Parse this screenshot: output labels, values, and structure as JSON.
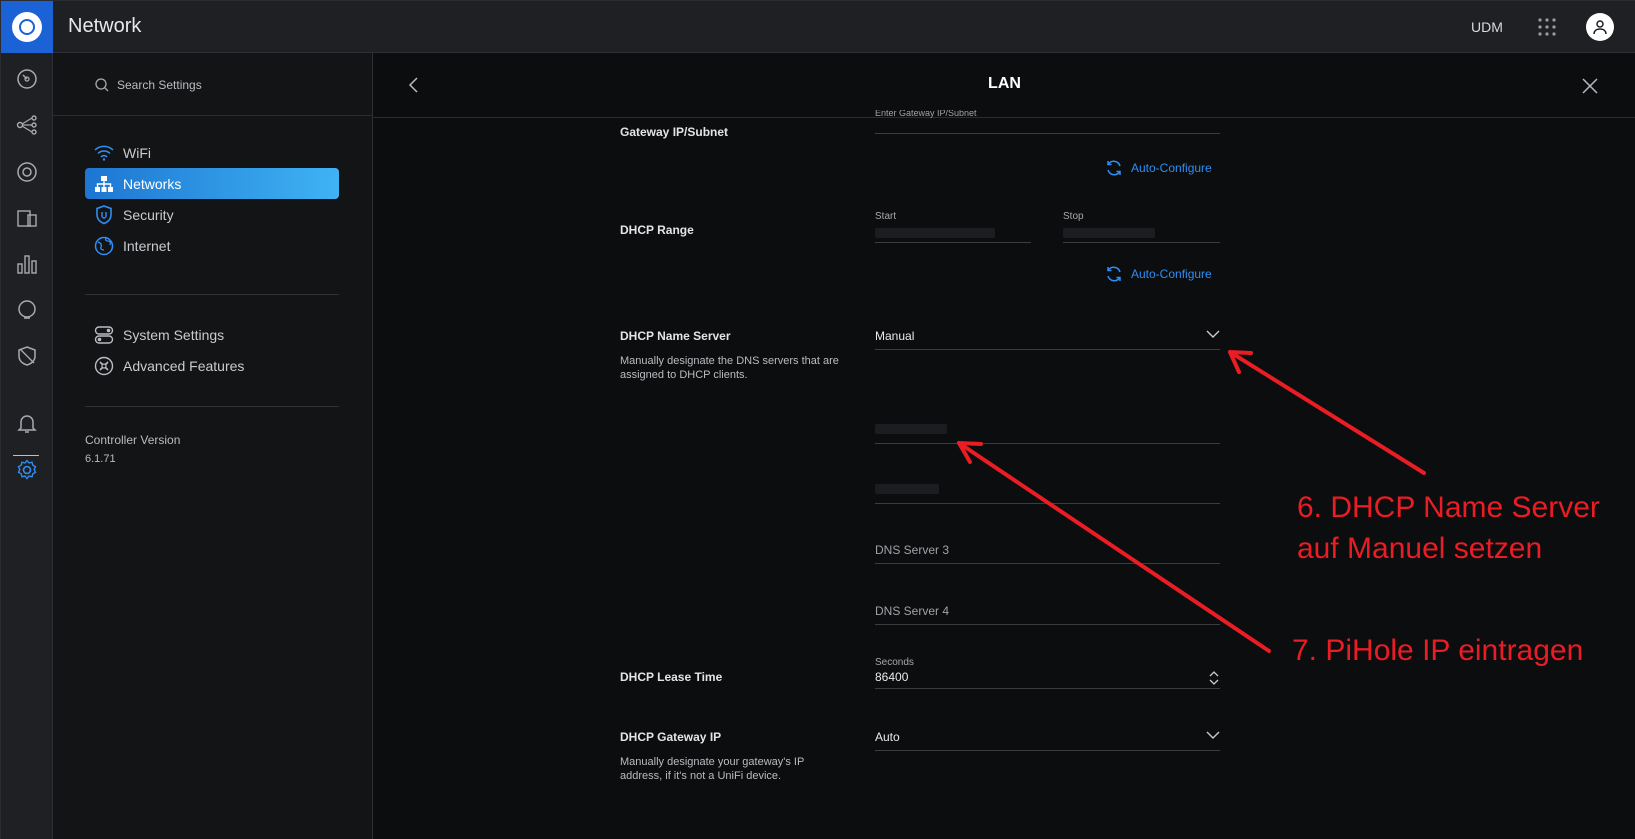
{
  "app": {
    "title": "Network",
    "device": "UDM"
  },
  "sidebar": {
    "search_placeholder": "Search Settings",
    "items": [
      {
        "label": "WiFi",
        "icon": "wifi-icon"
      },
      {
        "label": "Networks",
        "icon": "networks-icon",
        "active": true
      },
      {
        "label": "Security",
        "icon": "shield-icon"
      },
      {
        "label": "Internet",
        "icon": "globe-icon"
      }
    ],
    "items2": [
      {
        "label": "System Settings",
        "icon": "toggles-icon"
      },
      {
        "label": "Advanced Features",
        "icon": "tools-icon"
      }
    ],
    "controller_label": "Controller Version",
    "controller_version": "6.1.71"
  },
  "rail": {
    "icons": [
      "dashboard-icon",
      "topology-icon",
      "devices-icon",
      "clients-icon",
      "statistics-icon",
      "insights-icon",
      "traffic-icon",
      "alerts-icon",
      "settings-icon"
    ]
  },
  "panel": {
    "title": "LAN",
    "gateway": {
      "label": "Gateway IP/Subnet",
      "placeholder": "Enter Gateway IP/Subnet",
      "auto_configure": "Auto-Configure"
    },
    "dhcp_range": {
      "label": "DHCP Range",
      "start_label": "Start",
      "stop_label": "Stop",
      "auto_configure": "Auto-Configure"
    },
    "dhcp_name_server": {
      "label": "DHCP Name Server",
      "value": "Manual",
      "description": "Manually designate the DNS servers that are assigned to DHCP clients.",
      "dns3_placeholder": "DNS Server 3",
      "dns4_placeholder": "DNS Server 4"
    },
    "lease_time": {
      "label": "DHCP Lease Time",
      "unit_label": "Seconds",
      "value": "86400"
    },
    "gateway_ip": {
      "label": "DHCP Gateway IP",
      "value": "Auto",
      "description": "Manually designate your gateway's IP address, if it's not a UniFi device."
    }
  },
  "annotations": {
    "step6_line1": "6. DHCP Name Server",
    "step6_line2": "auf Manuel setzen",
    "step7": "7. PiHole IP eintragen",
    "color": "#ea1c24"
  },
  "colors": {
    "accent": "#1d76d2",
    "link": "#2f8ef5",
    "brand": "#1b62d6"
  }
}
